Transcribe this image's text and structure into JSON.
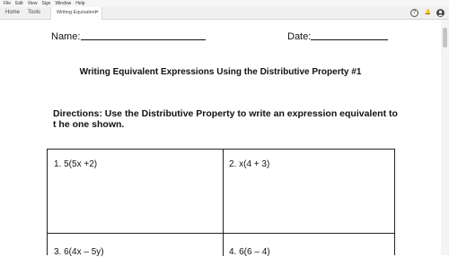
{
  "menu": [
    "File",
    "Edit",
    "View",
    "Sign",
    "Window",
    "Help"
  ],
  "tabs": {
    "home": "Home",
    "tools": "Tools",
    "document": "Writing Equivalent ...",
    "close": "×"
  },
  "toolbar_icons": {
    "help": "?",
    "bell": "🔔"
  },
  "worksheet": {
    "name_label": "Name:",
    "date_label": "Date:",
    "title": "Writing Equivalent Expressions Using the Distributive Property #1",
    "directions": "Directions: Use the Distributive Property to write an expression equivalent to t he one shown.",
    "problems": [
      "1.  5(5x +2)",
      "2.  x(4 + 3)",
      "3.  6(4x – 5y)",
      "4.  6(6 – 4)"
    ]
  }
}
